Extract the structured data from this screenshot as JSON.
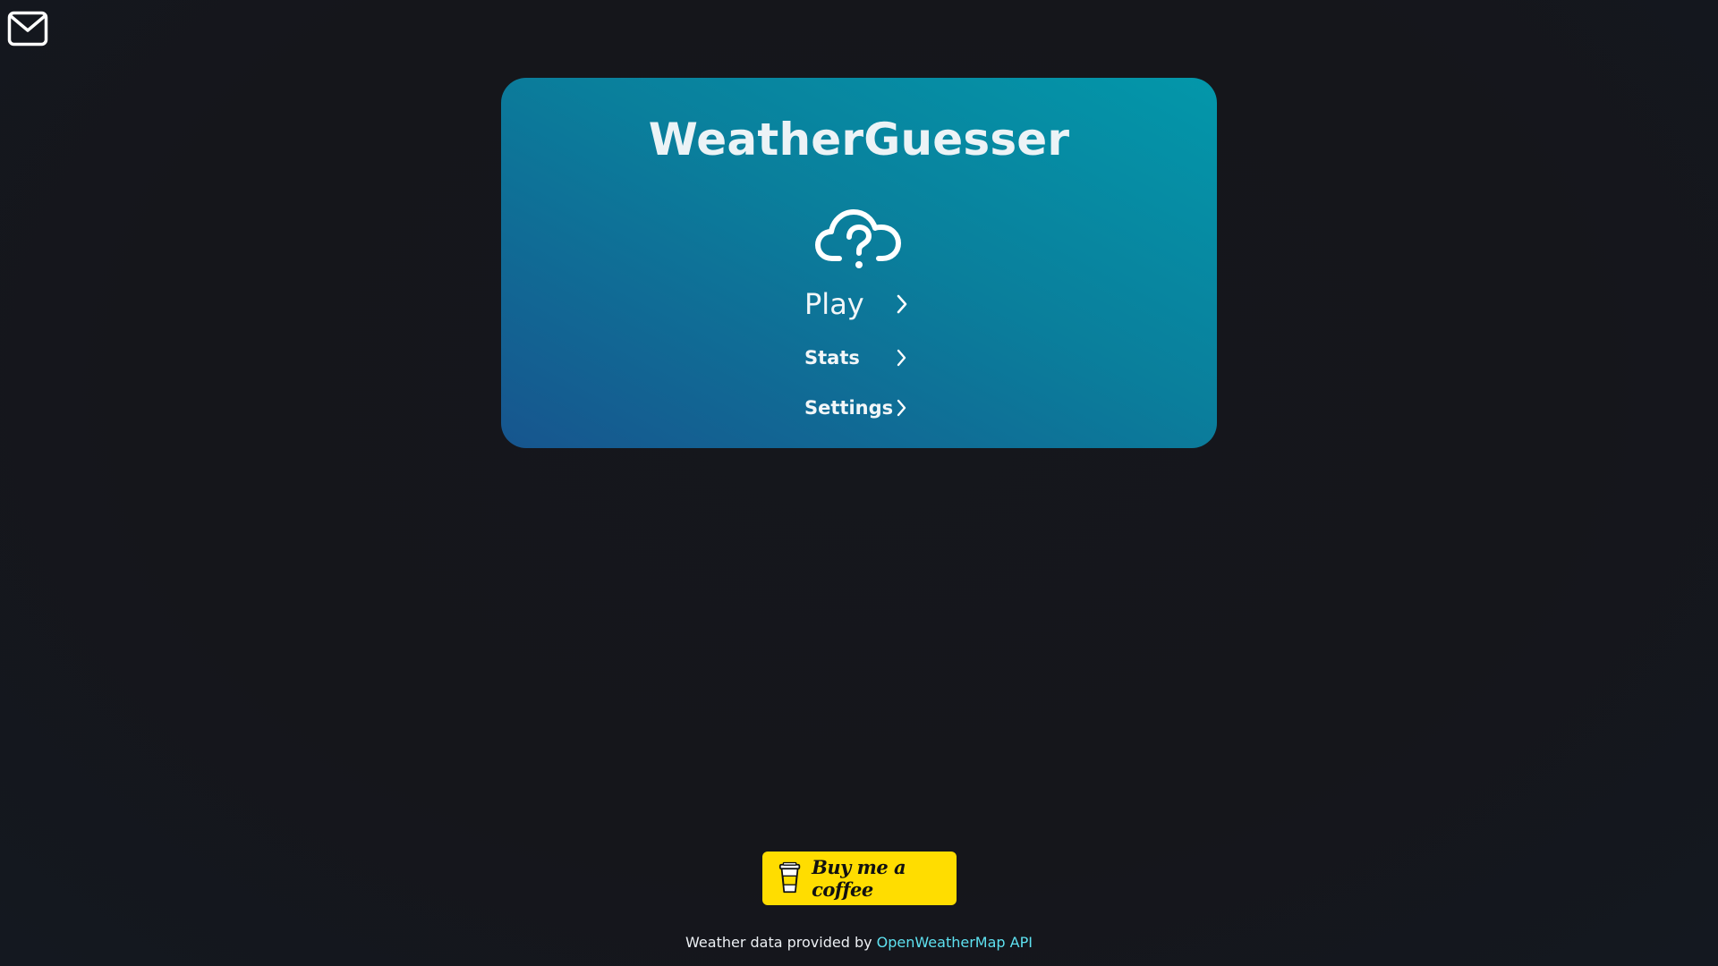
{
  "app": {
    "title": "WeatherGuesser"
  },
  "header": {
    "mail_icon": "mail-icon"
  },
  "menu": {
    "hero_icon": "cloud-question-icon",
    "items": [
      {
        "label": "Play",
        "icon": "chevron-right-icon"
      },
      {
        "label": "Stats",
        "icon": "chevron-right-icon"
      },
      {
        "label": "Settings",
        "icon": "chevron-right-icon"
      }
    ]
  },
  "donate": {
    "label": "Buy me a coffee",
    "icon": "coffee-cup-icon",
    "color": "#ffdd00"
  },
  "footer": {
    "prefix": "Weather data provided by ",
    "link_label": "OpenWeatherMap API",
    "link_color": "#5ee1f0"
  },
  "colors": {
    "background": "#15161b",
    "card_gradient_top": "#0397aa",
    "card_gradient_bottom": "#17558e"
  }
}
